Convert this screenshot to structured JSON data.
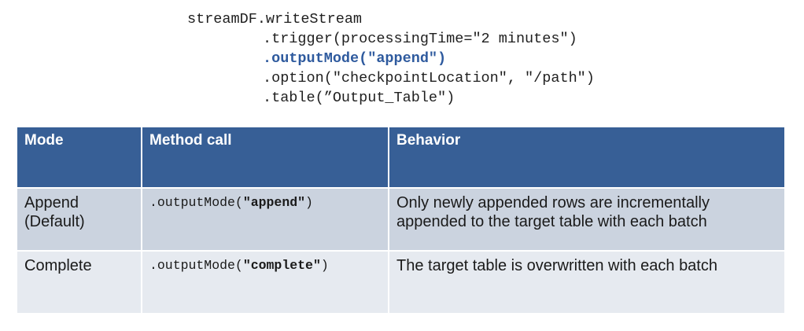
{
  "code": {
    "line1": "streamDF.writeStream",
    "line2": ".trigger(processingTime=\"2 minutes\")",
    "line3": ".outputMode(\"append\")",
    "line4": ".option(\"checkpointLocation\", \"/path\")",
    "line5": ".table(”Output_Table\")"
  },
  "table": {
    "headers": [
      "Mode",
      "Method call",
      "Behavior"
    ],
    "rows": [
      {
        "mode": "Append (Default)",
        "method_prefix": ".outputMode(",
        "method_arg": "\"append\"",
        "method_suffix": ")",
        "behavior": "Only newly appended rows are incrementally appended to the target table with each batch"
      },
      {
        "mode": "Complete",
        "method_prefix": ".outputMode(",
        "method_arg": "\"complete\"",
        "method_suffix": ")",
        "behavior": "The target table is overwritten with each batch"
      }
    ]
  },
  "colors": {
    "header_bg": "#375f96",
    "row1_bg": "#cbd3df",
    "row2_bg": "#e6eaf0",
    "code_highlight": "#2e5a9e"
  }
}
